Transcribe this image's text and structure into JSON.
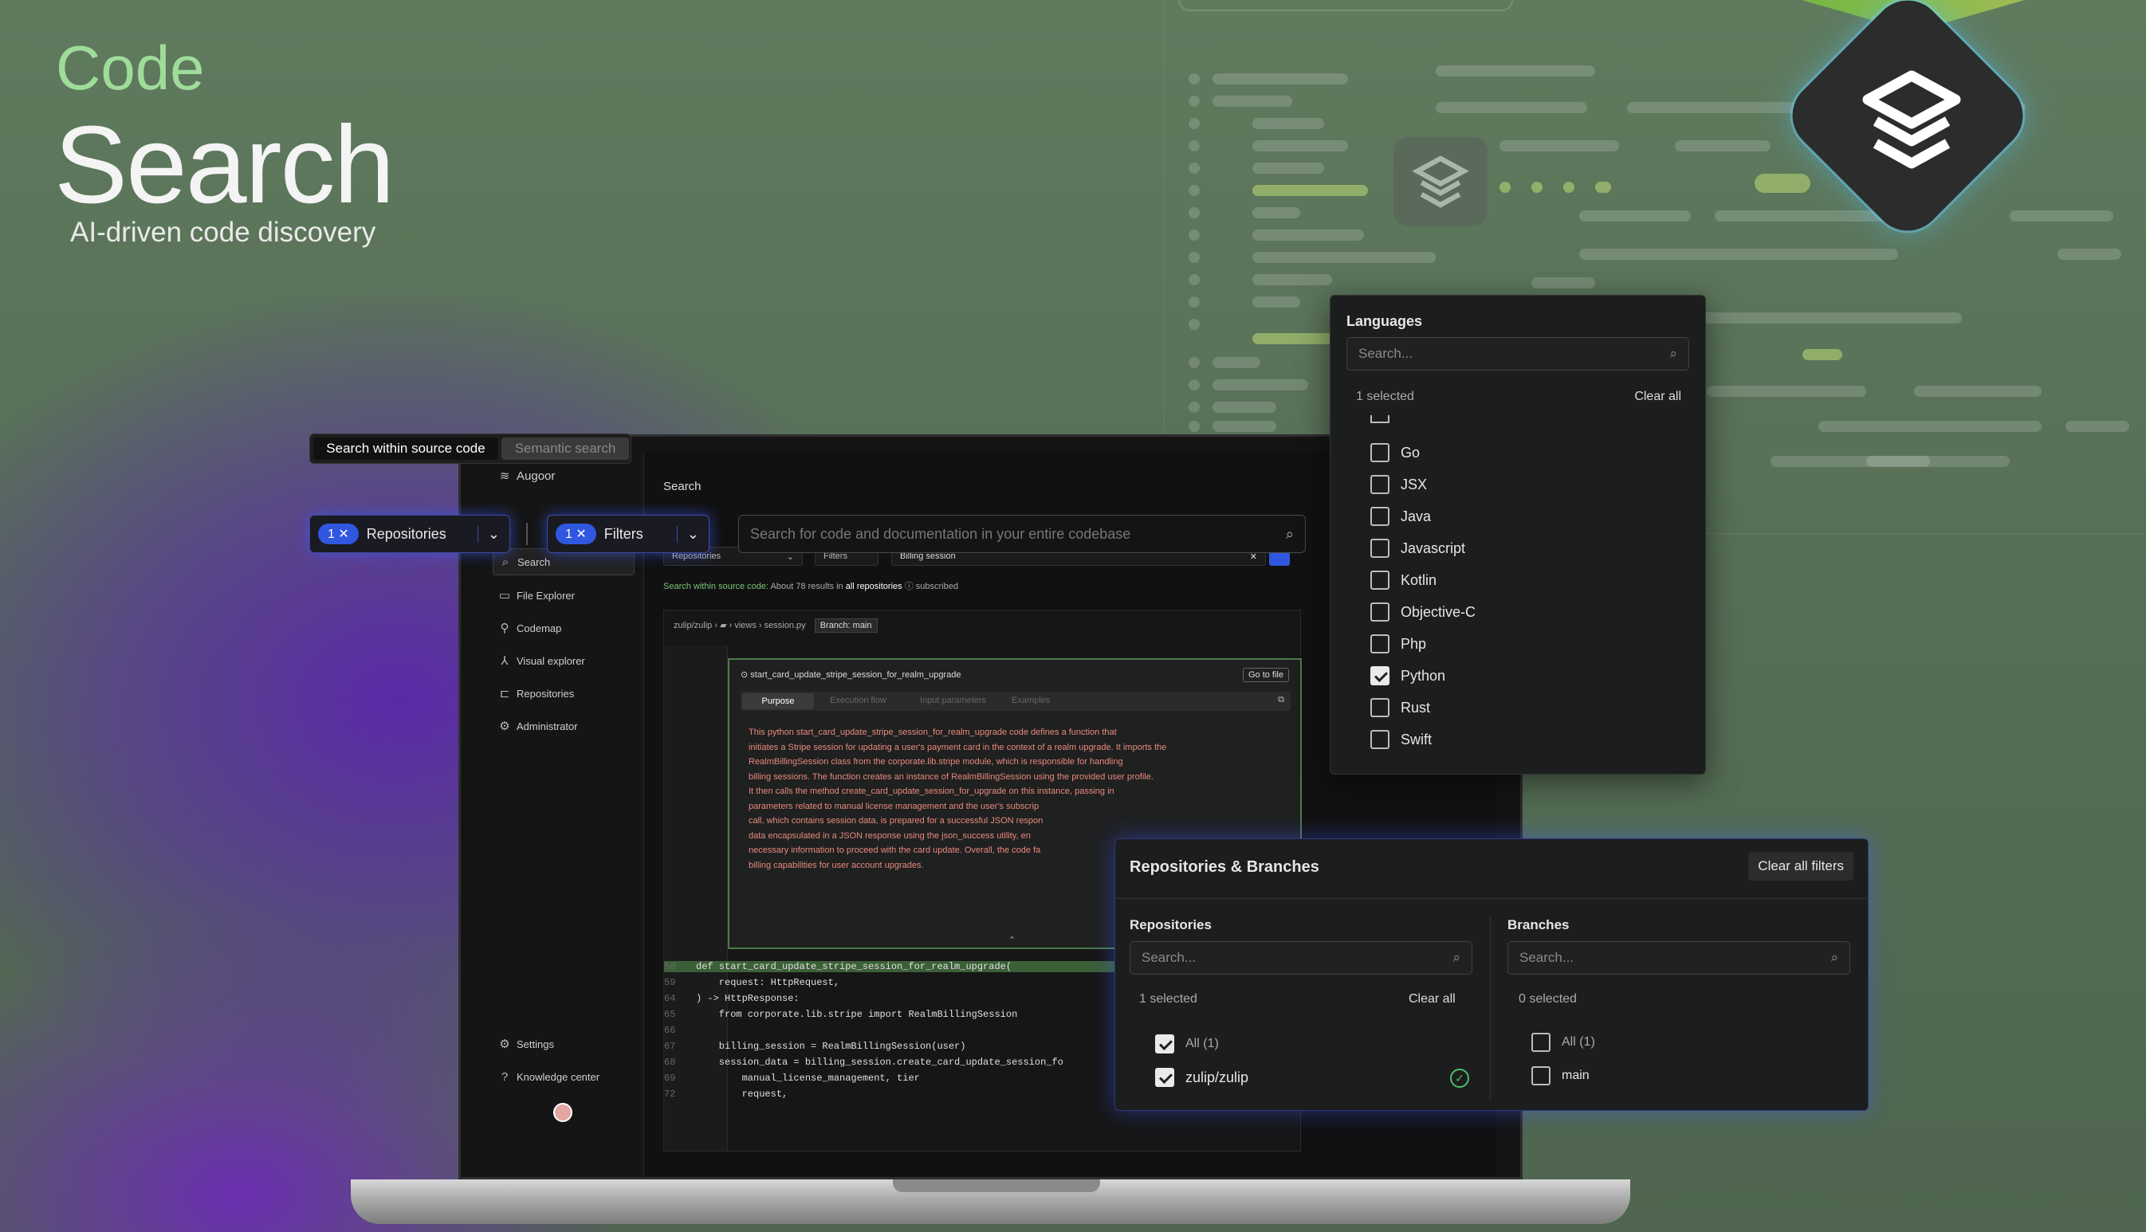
{
  "hero": {
    "small": "Code",
    "title": "Search",
    "subtitle": "AI-driven code discovery"
  },
  "colors": {
    "accent_blue": "#2f57e0",
    "hero_green": "#9fdc9a",
    "bg_green": "#5b735a",
    "glow_purple": "#5a2aa8"
  },
  "mode_tabs": [
    {
      "label": "Search within source code",
      "active": true
    },
    {
      "label": "Semantic search",
      "active": false
    }
  ],
  "filter_bar": {
    "repositories": {
      "count": "1",
      "label": "Repositories"
    },
    "filters": {
      "count": "1",
      "label": "Filters"
    },
    "search_placeholder": "Search for code and documentation in your entire codebase"
  },
  "sidebar": {
    "brand": "Augoor",
    "items": [
      {
        "label": "Search",
        "icon": "search-icon"
      },
      {
        "label": "File Explorer",
        "icon": "folder-icon"
      },
      {
        "label": "Codemap",
        "icon": "codemap-icon"
      },
      {
        "label": "Visual explorer",
        "icon": "graph-icon"
      },
      {
        "label": "Repositories",
        "icon": "repo-icon"
      },
      {
        "label": "Administrator",
        "icon": "admin-icon"
      }
    ],
    "bottom": [
      {
        "label": "Settings",
        "icon": "gear-icon"
      },
      {
        "label": "Knowledge center",
        "icon": "help-icon"
      }
    ]
  },
  "app": {
    "page_title": "Search",
    "inner_filter": {
      "repositories": "Repositories",
      "filters": "Filters",
      "query": "Billing session"
    },
    "results_line": {
      "prefix": "Search within source code:",
      "count": "About 78 results in",
      "scope": "all repositories",
      "suffix": "subscribed"
    },
    "breadcrumb": {
      "repo": "zulip/zulip",
      "folder": "views",
      "file": "session.py",
      "branch": "Branch: main"
    },
    "card": {
      "function": "start_card_update_stripe_session_for_realm_upgrade",
      "goto": "Go to file",
      "tabs": [
        "Purpose",
        "Execution flow",
        "Input parameters",
        "Examples"
      ],
      "text": [
        "This python start_card_update_stripe_session_for_realm_upgrade code defines a function that",
        "initiates a Stripe session for updating a user's payment card in the context of a realm upgrade. It imports the",
        "RealmBillingSession class from the corporate.lib.stripe module, which is responsible for handling",
        "billing sessions. The function creates an instance of RealmBillingSession using the provided user profile.",
        "It then calls the method create_card_update_session_for_upgrade on this instance, passing in",
        "parameters related to manual license management and the user's subscrip",
        "call, which contains session data, is prepared for a successful JSON respon",
        "data encapsulated in a JSON response using the json_success utility, en",
        "necessary information to proceed with the card update. Overall, the code fa",
        "billing capabilities for user account upgrades."
      ]
    },
    "code": [
      {
        "n": "58",
        "t": "def start_card_update_stripe_session_for_realm_upgrade("
      },
      {
        "n": "59",
        "t": "    request: HttpRequest,"
      },
      {
        "n": "64",
        "t": ") -> HttpResponse:"
      },
      {
        "n": "65",
        "t": "    from corporate.lib.stripe import RealmBillingSession"
      },
      {
        "n": "66",
        "t": ""
      },
      {
        "n": "67",
        "t": "    billing_session = RealmBillingSession(user)"
      },
      {
        "n": "68",
        "t": "    session_data = billing_session.create_card_update_session_fo"
      },
      {
        "n": "69",
        "t": "        manual_license_management, tier"
      },
      {
        "n": "72",
        "t": "        request,"
      }
    ]
  },
  "languages": {
    "title": "Languages",
    "search_placeholder": "Search...",
    "selected": "1 selected",
    "clear": "Clear all",
    "items": [
      {
        "label": "Go",
        "checked": false
      },
      {
        "label": "JSX",
        "checked": false
      },
      {
        "label": "Java",
        "checked": false
      },
      {
        "label": "Javascript",
        "checked": false
      },
      {
        "label": "Kotlin",
        "checked": false
      },
      {
        "label": "Objective-C",
        "checked": false
      },
      {
        "label": "Php",
        "checked": false
      },
      {
        "label": "Python",
        "checked": true
      },
      {
        "label": "Rust",
        "checked": false
      },
      {
        "label": "Swift",
        "checked": false
      }
    ]
  },
  "repos_branches": {
    "title": "Repositories & Branches",
    "clear_all": "Clear all filters",
    "repositories": {
      "title": "Repositories",
      "placeholder": "Search...",
      "selected": "1 selected",
      "clear": "Clear all",
      "items": [
        {
          "label": "All (1)",
          "checked": true
        },
        {
          "label": "zulip/zulip",
          "checked": true
        }
      ]
    },
    "branches": {
      "title": "Branches",
      "placeholder": "Search...",
      "selected": "0 selected",
      "items": [
        {
          "label": "All (1)",
          "checked": false
        },
        {
          "label": "main",
          "checked": false
        }
      ]
    }
  }
}
